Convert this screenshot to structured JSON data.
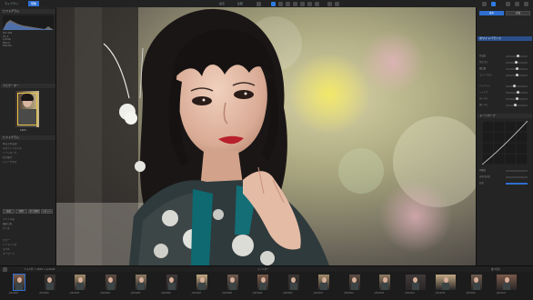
{
  "topbar": {
    "tabs": [
      "ライブラリ",
      "現像"
    ],
    "view_tabs": [
      "表示",
      "比較",
      "調整"
    ]
  },
  "left_panel": {
    "histogram_title": "ヒストグラム",
    "exif_rows": [
      "ISO 400",
      "f/1.4",
      "1/250s",
      "85mm",
      "EOS R5"
    ],
    "navigator_title": "ナビゲーター",
    "navigator_zoom": "100%",
    "history_title": "ヒストグラム",
    "history_items": [
      "明るさを変更",
      "ホワイトバランス",
      "トーンカーブ",
      "切り抜き",
      "シャープネス"
    ],
    "buttons": [
      "追加",
      "削除",
      "全て適用",
      "リセット"
    ],
    "info_rows": [
      "ファイル名",
      "撮影日時",
      "サイズ",
      "カラー",
      "レーティング",
      "ラベル",
      "キーワード"
    ]
  },
  "right_panel": {
    "header_buttons": [
      "基本",
      "詳細"
    ],
    "section_title": "ホワイトバランス",
    "sliders": [
      {
        "label": "色温度",
        "value": 0.55
      },
      {
        "label": "色かぶり",
        "value": 0.48
      },
      {
        "label": "露出量",
        "value": 0.5
      },
      {
        "label": "コントラスト",
        "value": 0.52
      },
      {
        "label": "ハイライト",
        "value": 0.4
      },
      {
        "label": "シャドウ",
        "value": 0.58
      },
      {
        "label": "白レベル",
        "value": 0.5
      },
      {
        "label": "黒レベル",
        "value": 0.45
      }
    ],
    "curve_title": "トーンカーブ",
    "lower_rows": [
      "明瞭度",
      "自然な彩度",
      "彩度"
    ]
  },
  "strip_bar": {
    "path": "フォルダ > 2024 > portrait",
    "filter_label": "フィルター",
    "sort_label": "並べ替え"
  },
  "filmstrip": {
    "thumbs": [
      {
        "name": "_DSC0001"
      },
      {
        "name": "_DSC0002"
      },
      {
        "name": "_DSC0003"
      },
      {
        "name": "_DSC0004"
      },
      {
        "name": "_DSC0005"
      },
      {
        "name": "_DSC0006"
      },
      {
        "name": "_DSC0007"
      },
      {
        "name": "_DSC0008"
      },
      {
        "name": "_DSC0009"
      },
      {
        "name": "_DSC0010"
      },
      {
        "name": "_DSC0011"
      },
      {
        "name": "_DSC0012"
      },
      {
        "name": "_DSC0013"
      },
      {
        "name": "_DSC0014"
      },
      {
        "name": "_DSC0015"
      },
      {
        "name": "_DSC0016"
      },
      {
        "name": "_DSC0017"
      }
    ]
  },
  "colors": {
    "accent": "#2f6fd1",
    "panel": "#242424",
    "lips": "#b8202a",
    "kimono": "#2e3a3c"
  }
}
